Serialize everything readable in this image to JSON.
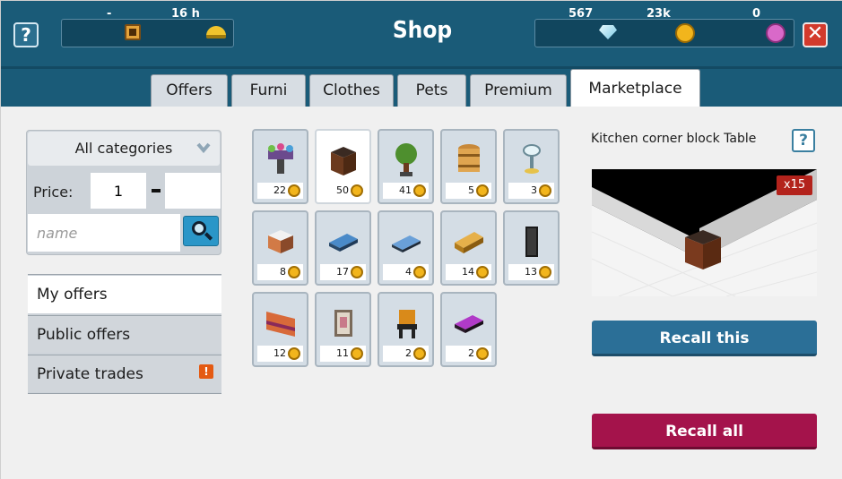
{
  "header": {
    "title": "Shop",
    "help_label": "?",
    "close_label": "✕",
    "stats": {
      "badge_value": "-",
      "hc_value": "16 h"
    },
    "currency": {
      "diamonds": "567",
      "credits": "23k",
      "points": "0"
    }
  },
  "tabs": [
    {
      "label": "Offers"
    },
    {
      "label": "Furni"
    },
    {
      "label": "Clothes"
    },
    {
      "label": "Pets"
    },
    {
      "label": "Premium"
    },
    {
      "label": "Marketplace",
      "active": true
    }
  ],
  "filters": {
    "category": "All categories",
    "price_label": "Price:",
    "price_min": "1",
    "price_max": "",
    "name_placeholder": "name"
  },
  "nav": [
    {
      "label": "My offers",
      "active": true
    },
    {
      "label": "Public offers"
    },
    {
      "label": "Private trades",
      "alert": "!"
    }
  ],
  "items": [
    {
      "icon": "fireworks-icon",
      "price": "22"
    },
    {
      "icon": "corner-block-icon",
      "price": "50",
      "selected": true
    },
    {
      "icon": "tree-icon",
      "price": "41"
    },
    {
      "icon": "barrel-icon",
      "price": "5"
    },
    {
      "icon": "glass-icon",
      "price": "3"
    },
    {
      "icon": "cube-icon",
      "price": "8"
    },
    {
      "icon": "bed-icon",
      "price": "17"
    },
    {
      "icon": "mattress-icon",
      "price": "4"
    },
    {
      "icon": "gold-bars-icon",
      "price": "14"
    },
    {
      "icon": "door-icon",
      "price": "13"
    },
    {
      "icon": "sunset-painting-icon",
      "price": "12"
    },
    {
      "icon": "framed-picture-icon",
      "price": "11"
    },
    {
      "icon": "bench-icon",
      "price": "2"
    },
    {
      "icon": "purple-couch-icon",
      "price": "2"
    }
  ],
  "selected_item": {
    "title": "Kitchen corner block Table",
    "count_badge": "x15",
    "help_label": "?"
  },
  "actions": {
    "recall_this": "Recall this",
    "recall_all": "Recall all"
  },
  "colors": {
    "header_bg": "#1a5b78",
    "recall_this": "#2b6f97",
    "recall_all": "#a4134b",
    "close": "#d33a2c"
  }
}
